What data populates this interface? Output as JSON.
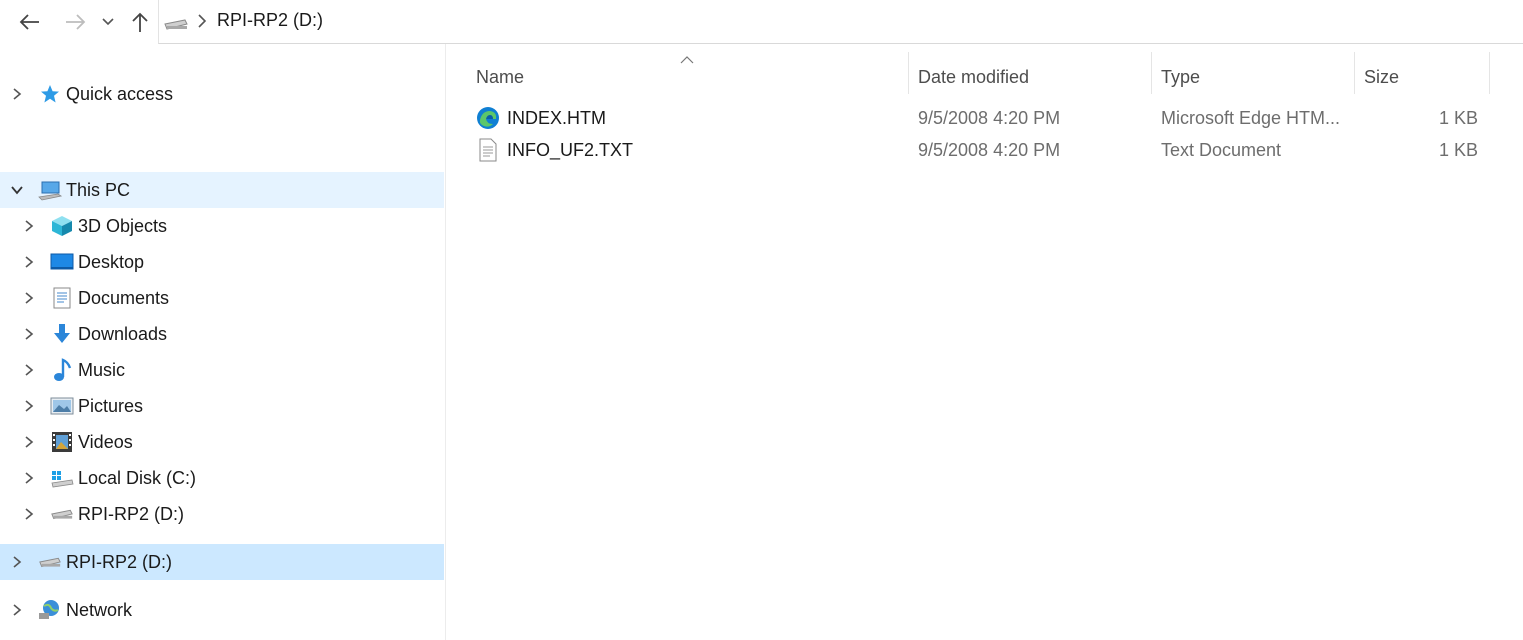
{
  "window": {
    "address": {
      "crumbs": [
        "RPI-RP2 (D:)"
      ]
    }
  },
  "nav_icons": [
    "back-arrow-icon",
    "forward-arrow-icon",
    "recent-dropdown-icon",
    "up-arrow-icon"
  ],
  "sidebar": {
    "quick_access": "Quick access",
    "this_pc": "This PC",
    "pc_items": [
      "3D Objects",
      "Desktop",
      "Documents",
      "Downloads",
      "Music",
      "Pictures",
      "Videos",
      "Local Disk (C:)",
      "RPI-RP2 (D:)"
    ],
    "removable": "RPI-RP2 (D:)",
    "network": "Network"
  },
  "columns": {
    "name": "Name",
    "date": "Date modified",
    "type": "Type",
    "size": "Size"
  },
  "files": [
    {
      "name": "INDEX.HTM",
      "date": "9/5/2008 4:20 PM",
      "type": "Microsoft Edge HTM...",
      "size": "1 KB",
      "icon": "edge-html-icon"
    },
    {
      "name": "INFO_UF2.TXT",
      "date": "9/5/2008 4:20 PM",
      "type": "Text Document",
      "size": "1 KB",
      "icon": "text-document-icon"
    }
  ],
  "colors": {
    "selected": "#cce8ff",
    "hover": "#e5f3ff",
    "accent": "#0078d4"
  }
}
